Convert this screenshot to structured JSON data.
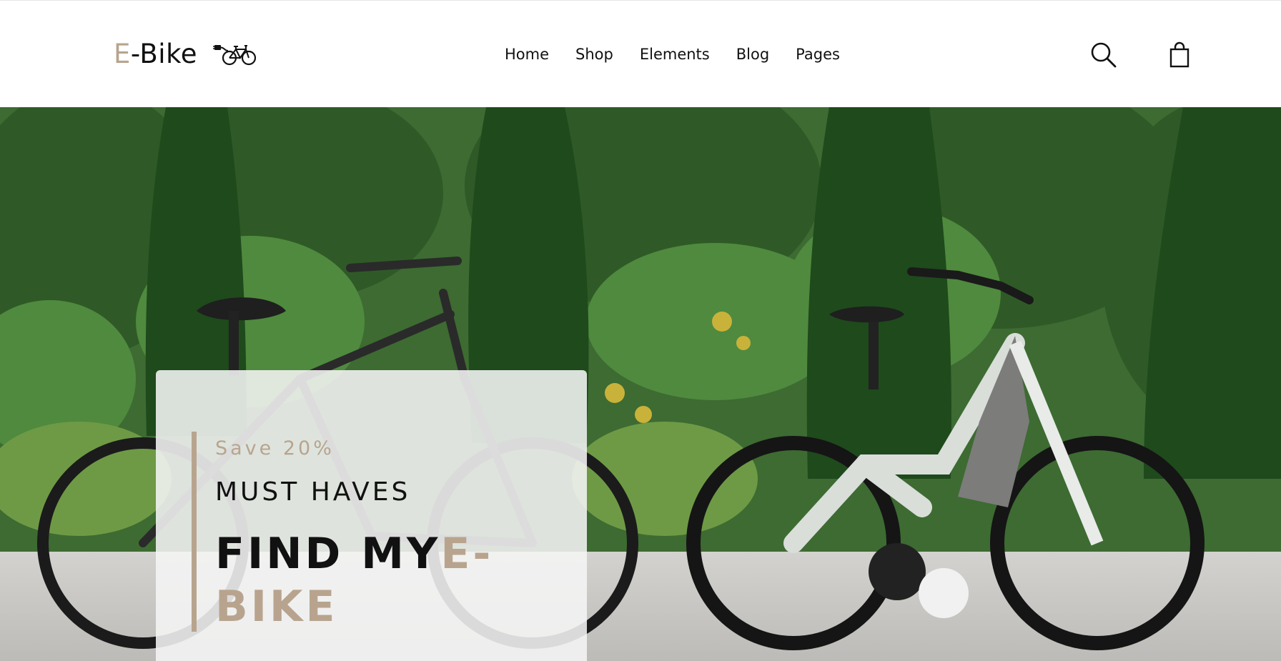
{
  "brand": {
    "name_prefix": "E",
    "name_rest": "-Bike",
    "accent_color": "#b8a48e",
    "logo_icon": "electric-bike-plug-icon"
  },
  "nav": {
    "items": [
      {
        "label": "Home"
      },
      {
        "label": "Shop"
      },
      {
        "label": "Elements"
      },
      {
        "label": "Blog"
      },
      {
        "label": "Pages"
      }
    ]
  },
  "header_actions": {
    "search_icon": "search-icon",
    "cart_icon": "shopping-bag-icon"
  },
  "hero": {
    "promo": {
      "save_text": "Save 20%",
      "subtitle": "MUST HAVES",
      "title_main": "FIND MY",
      "title_accent": "E-BIKE"
    }
  }
}
